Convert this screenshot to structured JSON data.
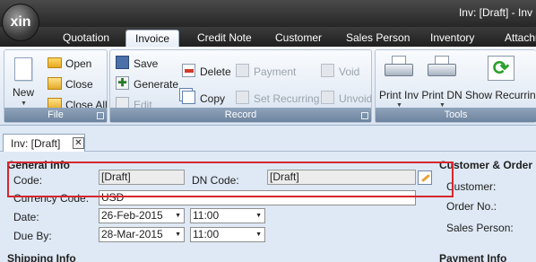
{
  "app": {
    "logo": "xin",
    "title": "Inv: [Draft] - Inv"
  },
  "ribbon_tabs": [
    "Quotation",
    "Invoice",
    "Credit Note",
    "Customer",
    "Sales Person",
    "Inventory",
    "Attachm"
  ],
  "active_tab": "Invoice",
  "file_group": {
    "label": "File",
    "new": "New",
    "open": "Open",
    "close": "Close",
    "close_all": "Close All"
  },
  "record_group": {
    "label": "Record",
    "save": "Save",
    "generate": "Generate",
    "edit": "Edit",
    "delete": "Delete",
    "copy": "Copy",
    "payment": "Payment",
    "set_recurring": "Set Recurring",
    "void": "Void",
    "unvoid": "Unvoid"
  },
  "tools_group": {
    "label": "Tools",
    "print_inv": "Print Inv",
    "print_dn": "Print DN",
    "show_recurring": "Show Recurring"
  },
  "doc_tab": {
    "title": "Inv: [Draft]",
    "close": "✕"
  },
  "general_info": {
    "heading": "General Info",
    "code_label": "Code:",
    "code_value": "[Draft]",
    "dn_code_label": "DN Code:",
    "dn_code_value": "[Draft]",
    "currency_label": "Currency Code:",
    "currency_value": "USD",
    "date_label": "Date:",
    "date_value": "26-Feb-2015",
    "date_time": "11:00",
    "due_label": "Due By:",
    "due_value": "28-Mar-2015",
    "due_time": "11:00"
  },
  "customer_order": {
    "heading": "Customer & Order",
    "customer_label": "Customer:",
    "order_label": "Order No.:",
    "sales_label": "Sales Person:"
  },
  "footer_sections": {
    "shipping": "Shipping Info",
    "payment": "Payment Info"
  },
  "colors": {
    "highlight": "#d7262e",
    "ribbon_dark": "#262626"
  }
}
